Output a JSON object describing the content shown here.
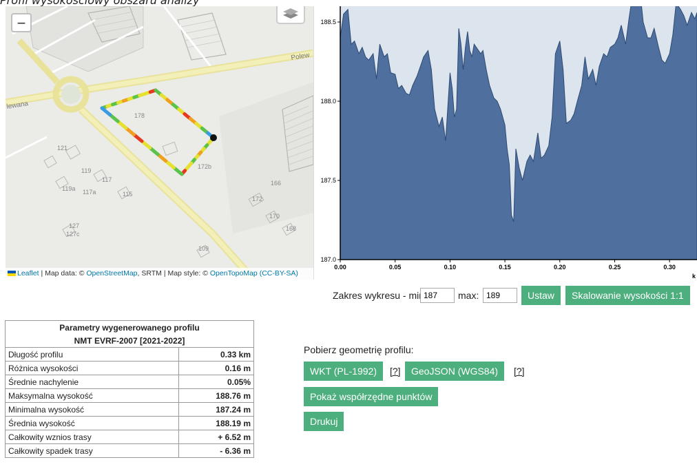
{
  "caption": "Profil wysokościowy obszaru analizy",
  "map": {
    "zoom_out_label": "−",
    "streets": [
      "Polew",
      "lewana"
    ],
    "house_numbers": [
      "178",
      "172b",
      "121",
      "119",
      "117",
      "115",
      "119a",
      "117a",
      "127",
      "127c",
      "109",
      "172",
      "170",
      "168",
      "166"
    ],
    "attribution": {
      "leaflet": "Leaflet",
      "sep1": " | Map data: © ",
      "osm": "OpenStreetMap",
      "sep2": ", SRTM | Map style: © ",
      "otm": "OpenTopoMap",
      "license": "(CC-BY-SA)"
    },
    "route_colors": [
      "#3b9be0",
      "#5bc24a",
      "#e6e030",
      "#f0a020",
      "#e53a20"
    ]
  },
  "chart_data": {
    "type": "area",
    "xlabel": "k",
    "ylabel": "",
    "xlim": [
      0,
      0.325
    ],
    "ylim": [
      187.0,
      188.6
    ],
    "fill_color": "#4f6f9e",
    "background": "#dce4ee",
    "x_ticks": [
      "0.00",
      "0.05",
      "0.10",
      "0.15",
      "0.20",
      "0.25",
      "0.30"
    ],
    "y_ticks": [
      "187.0",
      "187.5",
      "188.0",
      "188.5"
    ],
    "x": [
      0.0,
      0.003,
      0.007,
      0.01,
      0.013,
      0.017,
      0.02,
      0.023,
      0.026,
      0.03,
      0.033,
      0.036,
      0.04,
      0.043,
      0.046,
      0.05,
      0.053,
      0.056,
      0.06,
      0.063,
      0.066,
      0.07,
      0.073,
      0.076,
      0.08,
      0.083,
      0.086,
      0.09,
      0.093,
      0.096,
      0.1,
      0.102,
      0.104,
      0.106,
      0.108,
      0.11,
      0.112,
      0.114,
      0.116,
      0.118,
      0.12,
      0.122,
      0.124,
      0.126,
      0.128,
      0.13,
      0.133,
      0.136,
      0.14,
      0.143,
      0.146,
      0.15,
      0.152,
      0.154,
      0.156,
      0.158,
      0.16,
      0.163,
      0.166,
      0.17,
      0.173,
      0.176,
      0.18,
      0.183,
      0.186,
      0.19,
      0.193,
      0.196,
      0.2,
      0.203,
      0.206,
      0.21,
      0.213,
      0.216,
      0.22,
      0.223,
      0.226,
      0.23,
      0.233,
      0.236,
      0.24,
      0.243,
      0.246,
      0.25,
      0.253,
      0.256,
      0.26,
      0.263,
      0.266,
      0.27,
      0.273,
      0.276,
      0.28,
      0.283,
      0.286,
      0.29,
      0.293,
      0.296,
      0.3,
      0.303,
      0.306,
      0.31,
      0.313,
      0.316,
      0.32,
      0.323,
      0.325
    ],
    "y": [
      188.4,
      188.55,
      188.58,
      188.36,
      188.38,
      188.3,
      188.34,
      188.28,
      188.26,
      188.3,
      188.14,
      188.36,
      188.28,
      188.3,
      188.18,
      188.17,
      188.08,
      188.1,
      188.05,
      188.04,
      188.1,
      188.16,
      188.22,
      188.28,
      188.32,
      188.2,
      187.95,
      187.84,
      187.9,
      187.75,
      188.18,
      188.08,
      187.9,
      187.95,
      188.46,
      188.36,
      188.2,
      188.34,
      188.44,
      188.32,
      188.28,
      188.36,
      188.34,
      188.32,
      188.3,
      188.32,
      188.2,
      188.1,
      188.02,
      188.0,
      187.95,
      187.85,
      187.7,
      187.6,
      187.28,
      187.24,
      187.7,
      187.58,
      187.5,
      187.62,
      187.66,
      187.62,
      187.8,
      187.64,
      187.66,
      187.72,
      187.9,
      188.3,
      188.38,
      188.2,
      187.86,
      187.88,
      187.92,
      188.0,
      188.1,
      188.28,
      188.14,
      188.2,
      188.1,
      188.22,
      188.3,
      188.28,
      188.34,
      188.36,
      188.4,
      188.48,
      188.36,
      188.52,
      188.66,
      188.76,
      188.7,
      188.5,
      188.4,
      188.4,
      188.46,
      188.34,
      188.26,
      188.24,
      188.3,
      188.42,
      188.62,
      188.58,
      188.54,
      188.48,
      188.56,
      188.52,
      188.56
    ]
  },
  "range": {
    "label_min": "Zakres wykresu - min:",
    "min_value": "187",
    "label_max": "max:",
    "max_value": "189",
    "set_button": "Ustaw",
    "scale_button": "Skalowanie wysokości 1:1"
  },
  "params": {
    "title": "Parametry wygenerowanego profilu",
    "subtitle": "NMT EVRF-2007 [2021-2022]",
    "rows": [
      {
        "label": "Długość profilu",
        "value": "0.33 km"
      },
      {
        "label": "Różnica wysokości",
        "value": "0.16 m"
      },
      {
        "label": "Średnie nachylenie",
        "value": "0.05%"
      },
      {
        "label": "Maksymalna wysokość",
        "value": "188.76 m"
      },
      {
        "label": "Minimalna wysokość",
        "value": "187.24 m"
      },
      {
        "label": "Średnia wysokość",
        "value": "188.19 m"
      },
      {
        "label": "Całkowity wznios trasy",
        "value": "+ 6.52 m"
      },
      {
        "label": "Całkowity spadek trasy",
        "value": "- 6.36 m"
      }
    ]
  },
  "export": {
    "title": "Pobierz geometrię profilu:",
    "wkt_button": "WKT (PL-1992)",
    "geojson_button": "GeoJSON (WGS84)",
    "help_label": "[?]",
    "points_button": "Pokaż współrzędne punktów",
    "print_button": "Drukuj"
  },
  "colors": {
    "accent": "#4caf7d",
    "link": "#0078a8"
  }
}
